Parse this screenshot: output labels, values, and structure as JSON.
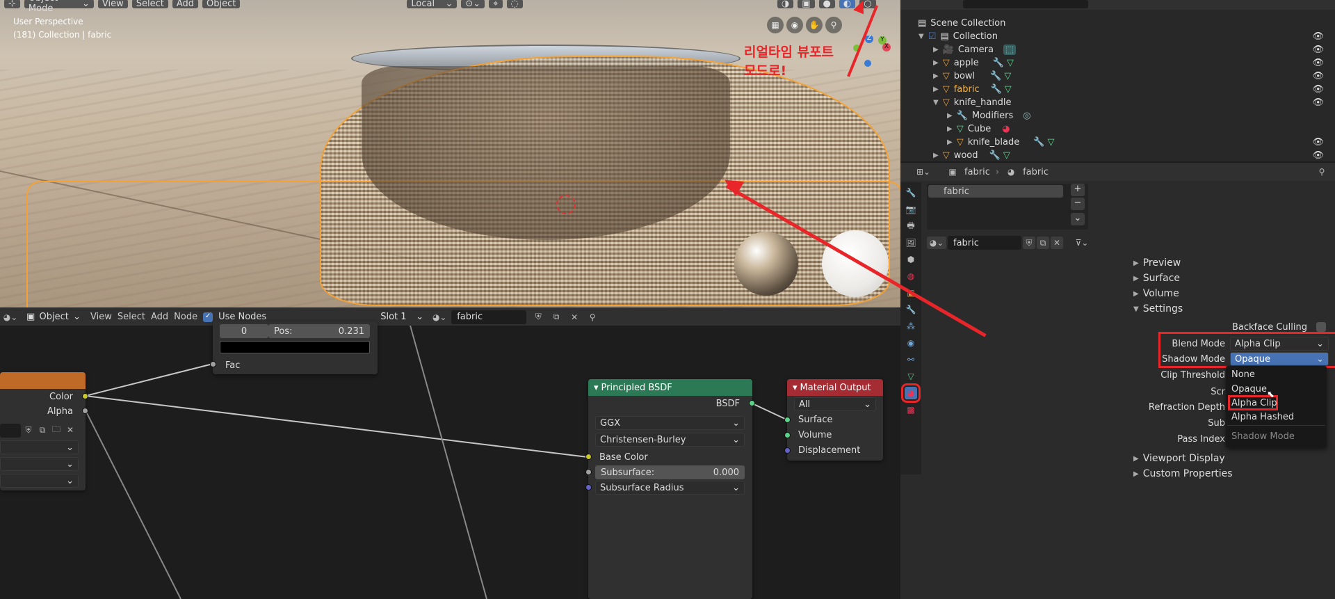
{
  "viewport_header": {
    "mode": "Object Mode",
    "menus": [
      "View",
      "Select",
      "Add",
      "Object"
    ],
    "transform": "Local"
  },
  "viewport": {
    "perspective": "User Perspective",
    "collection": "(181) Collection | fabric",
    "annotation_line1": "리얼타임 뷰포트",
    "annotation_line2": "모드로!",
    "gizmo": {
      "x": "X",
      "y": "Y",
      "z": "Z"
    }
  },
  "outliner": {
    "root": "Scene Collection",
    "collection": "Collection",
    "items": [
      "Camera",
      "apple",
      "bowl",
      "fabric",
      "knife_handle",
      "Modifiers",
      "Cube",
      "knife_blade",
      "wood"
    ]
  },
  "props": {
    "breadcrumb_obj": "fabric",
    "breadcrumb_mat": "fabric",
    "slot": "fabric",
    "material": "fabric",
    "sections": [
      "Preview",
      "Surface",
      "Volume",
      "Settings"
    ],
    "backface": "Backface Culling",
    "blend_label": "Blend Mode",
    "blend_value": "Alpha Clip",
    "shadow_label": "Shadow Mode",
    "shadow_value": "Opaque",
    "clip_label": "Clip Threshold",
    "scr_label": "Scr",
    "refraction_label": "Refraction Depth",
    "sub_label": "Sub",
    "pass_label": "Pass Index",
    "bottom_sections": [
      "Viewport Display",
      "Custom Properties"
    ],
    "dropdown": [
      "None",
      "Opaque",
      "Alpha Clip",
      "Alpha Hashed"
    ],
    "dropdown_title": "Shadow Mode"
  },
  "node_header": {
    "type": "Object",
    "menus": [
      "View",
      "Select",
      "Add",
      "Node"
    ],
    "use_nodes": "Use Nodes",
    "slot": "Slot 1",
    "material": "fabric"
  },
  "nodes": {
    "ramp": {
      "zero": "0",
      "pos_label": "Pos:",
      "pos_value": "0.231",
      "fac": "Fac"
    },
    "image": {
      "color": "Color",
      "alpha": "Alpha"
    },
    "bsdf": {
      "title": "Principled BSDF",
      "out": "BSDF",
      "dist": "GGX",
      "sss": "Christensen-Burley",
      "base": "Base Color",
      "subsurface_label": "Subsurface:",
      "subsurface_value": "0.000",
      "radius": "Subsurface Radius"
    },
    "output": {
      "title": "Material Output",
      "target": "All",
      "surface": "Surface",
      "volume": "Volume",
      "displacement": "Displacement"
    }
  },
  "colors": {
    "accent": "#4772b3",
    "selected": "#ffaf29",
    "annotation": "#e8262a",
    "bsdf_header": "#2b7a55",
    "output_header": "#a52c33",
    "image_header": "#c06a28"
  }
}
